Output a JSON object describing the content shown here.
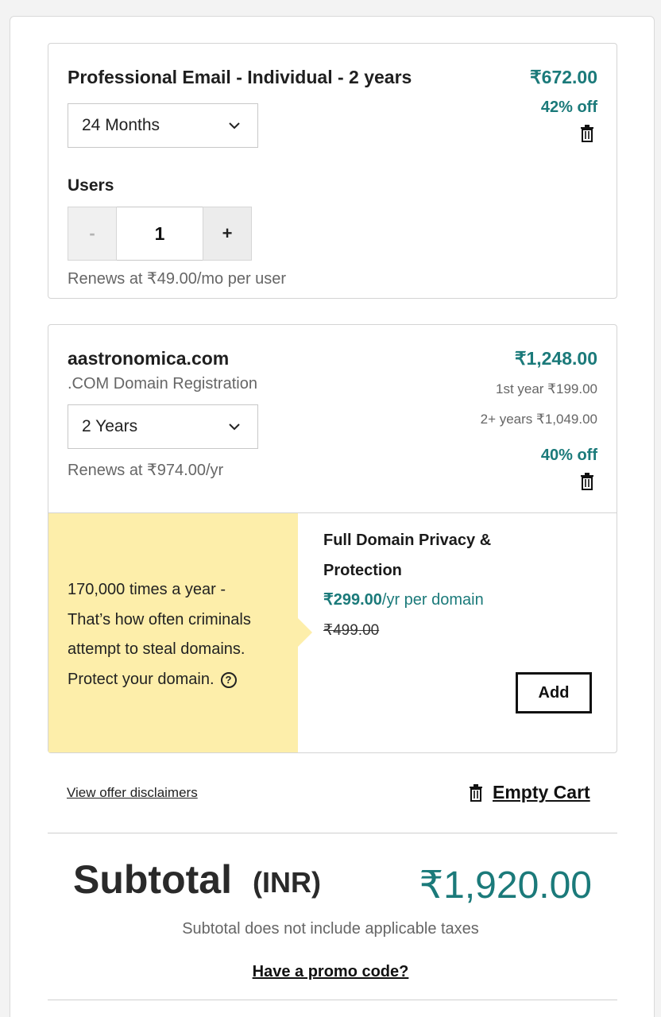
{
  "email_item": {
    "title": "Professional Email - Individual - 2 years",
    "price": "₹672.00",
    "discount": "42% off",
    "term_select": "24 Months",
    "users_label": "Users",
    "users_minus": "-",
    "users_value": "1",
    "users_plus": "+",
    "renew_note": "Renews at ₹49.00/mo per user"
  },
  "domain_item": {
    "name": "aastronomica.com",
    "subtitle": ".COM Domain Registration",
    "price": "₹1,248.00",
    "first_year": "1st year ₹199.00",
    "later_years": "2+ years ₹1,049.00",
    "discount": "40% off",
    "term_select": "2 Years",
    "renew_note": "Renews at ₹974.00/yr"
  },
  "upsell": {
    "pitch_line1": "170,000 times a year -",
    "pitch_line2": "That’s how often criminals",
    "pitch_line3": "attempt to steal domains.",
    "pitch_line4": "Protect your domain.",
    "help_glyph": "?",
    "title_line1": "Full Domain Privacy &",
    "title_line2": "Protection",
    "price_bold": "₹299.00",
    "price_suffix": "/yr per domain",
    "old_price": "₹499.00",
    "add_label": "Add"
  },
  "footer": {
    "disclaimers": "View offer disclaimers",
    "empty_cart": "Empty Cart",
    "subtotal_label": "Subtotal",
    "currency": "(INR)",
    "subtotal_value": "₹1,920.00",
    "tax_note": "Subtotal does not include applicable taxes",
    "promo": "Have a promo code?"
  },
  "colors": {
    "accent_teal": "#1b7a7a",
    "upsell_yellow": "#fdeeaa"
  }
}
